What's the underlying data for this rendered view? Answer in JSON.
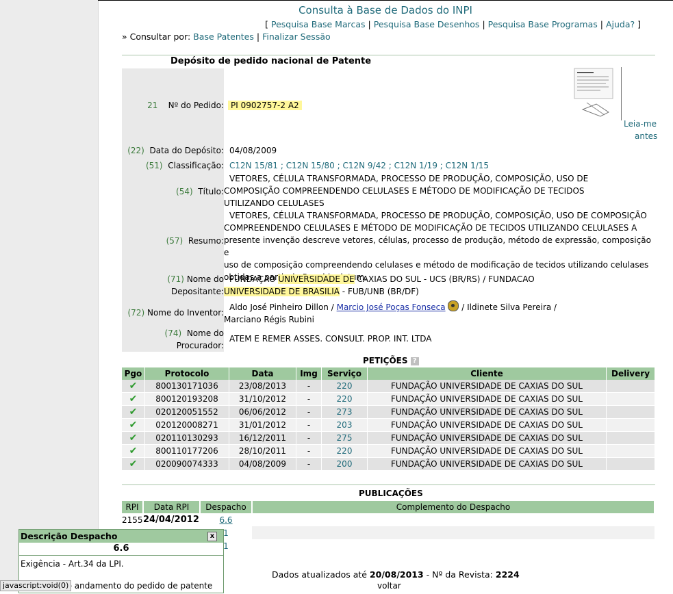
{
  "header": {
    "title": "Consulta à Base de Dados do INPI",
    "links_open": "[",
    "links": [
      "Pesquisa Base Marcas",
      "Pesquisa Base Desenhos",
      "Pesquisa Base Programas",
      "Ajuda?"
    ],
    "links_close": "]",
    "sep": "|",
    "consult_label": "» Consultar por:",
    "consult_links": [
      "Base Patentes",
      "Finalizar Sessão"
    ]
  },
  "patent": {
    "section_title": "Depósito de pedido nacional de Patente",
    "pedido_code": "21",
    "pedido_label": "Nº do Pedido:",
    "pedido_value": "PI 0902757-2 A2",
    "leia_me": "Leia-me",
    "antes": "antes",
    "deposito_code": "(22)",
    "deposito_label": "Data do Depósito:",
    "deposito_value": "04/08/2009",
    "classif_code": "(51)",
    "classif_label": "Classificação:",
    "classif_values": [
      "C12N 15/81",
      "C12N 15/80",
      "C12N 9/42",
      "C12N 1/19",
      "C12N 1/15"
    ],
    "classif_sep": ";",
    "titulo_code": "(54)",
    "titulo_label": "Título:",
    "titulo_lines": [
      "VETORES, CÉLULA TRANSFORMADA, PROCESSO DE PRODUÇÃO, COMPOSIÇÃO, USO DE",
      "COMPOSIÇÃO COMPREENDENDO CELULASES E MÉTODO DE MODIFICAÇÃO DE TECIDOS",
      "UTILIZANDO CELULASES"
    ],
    "resumo_code": "(57)",
    "resumo_label": "Resumo:",
    "resumo_lines": [
      "VETORES, CÉLULA TRANSFORMADA, PROCESSO DE PRODUÇÃO, COMPOSIÇÃO, USO DE COMPOSIÇÃO",
      "COMPREENDENDO CELULASES E MÉTODO DE MODIFICAÇÃO DE TECIDOS UTILIZANDO CELULASES A",
      "presente invenção descreve vetores, células, processo de produção, método de expressão, composição e",
      "uso de composição compreendendo celulases e método de modificação de tecidos utilizando celulases",
      "obtidas a partir de R. echinulatum."
    ],
    "depositante_code": "(71)",
    "depositante_label1": "Nome do",
    "depositante_label2": "Depositante:",
    "depositante_l1_a": "FUNDAÇAO ",
    "depositante_l1_hl": "UNIVERSIDADE DE",
    "depositante_l1_b": " CAXIAS DO SUL - UCS (BR/RS) / FUNDACAO",
    "depositante_l2_hl": "UNIVERSIDADE DE BRASILIA",
    "depositante_l2_b": " - FUB/UNB (BR/DF)",
    "inventor_code": "(72)",
    "inventor_label": "Nome do Inventor:",
    "inventor_a": "Aldo José Pinheiro Dillon /",
    "inventor_link": "Marcio José Poças Fonseca",
    "inventor_b": "/ Ildinete Silva Pereira /",
    "inventor_l2": "Marciano Régis Rubini",
    "procurador_code": "(74)",
    "procurador_label1": "Nome do",
    "procurador_label2": "Procurador:",
    "procurador_value": "ATEM E REMER ASSES. CONSULT. PROP. INT. LTDA"
  },
  "peticoes": {
    "title": "PETIÇÕES",
    "help": "?",
    "headers": [
      "Pgo",
      "Protocolo",
      "Data",
      "Img",
      "Serviço",
      "Cliente",
      "Delivery"
    ],
    "rows": [
      {
        "pgo": "✔",
        "protocolo": "800130171036",
        "data": "23/08/2013",
        "img": "-",
        "servico": "220",
        "cliente": "FUNDAÇÃO UNIVERSIDADE DE CAXIAS DO SUL",
        "delivery": ""
      },
      {
        "pgo": "✔",
        "protocolo": "800120193208",
        "data": "31/10/2012",
        "img": "-",
        "servico": "220",
        "cliente": "FUNDAÇÃO UNIVERSIDADE DE CAXIAS DO SUL",
        "delivery": ""
      },
      {
        "pgo": "✔",
        "protocolo": "020120051552",
        "data": "06/06/2012",
        "img": "-",
        "servico": "273",
        "cliente": "FUNDAÇÃO UNIVERSIDADE DE CAXIAS DO SUL",
        "delivery": ""
      },
      {
        "pgo": "✔",
        "protocolo": "020120008271",
        "data": "31/01/2012",
        "img": "-",
        "servico": "203",
        "cliente": "FUNDAÇÃO UNIVERSIDADE DE CAXIAS DO SUL",
        "delivery": ""
      },
      {
        "pgo": "✔",
        "protocolo": "020110130293",
        "data": "16/12/2011",
        "img": "-",
        "servico": "275",
        "cliente": "FUNDAÇÃO UNIVERSIDADE DE CAXIAS DO SUL",
        "delivery": ""
      },
      {
        "pgo": "✔",
        "protocolo": "800110177206",
        "data": "28/10/2011",
        "img": "-",
        "servico": "220",
        "cliente": "FUNDAÇÃO UNIVERSIDADE DE CAXIAS DO SUL",
        "delivery": ""
      },
      {
        "pgo": "✔",
        "protocolo": "020090074333",
        "data": "04/08/2009",
        "img": "-",
        "servico": "200",
        "cliente": "FUNDAÇÃO UNIVERSIDADE DE CAXIAS DO SUL",
        "delivery": ""
      }
    ]
  },
  "publicacoes": {
    "title": "PUBLICAÇÕES",
    "headers": [
      "RPI",
      "Data RPI",
      "Despacho",
      "Complemento do Despacho"
    ],
    "rows": [
      {
        "rpi": "2155",
        "data": "24/04/2012",
        "despacho": "6.6",
        "complemento": ""
      },
      {
        "rpi": "",
        "data": "",
        "despacho": "1",
        "complemento": ""
      },
      {
        "rpi": "",
        "data": "",
        "despacho": "1",
        "complemento": ""
      }
    ]
  },
  "footer": {
    "updated_prefix": "Dados atualizados até ",
    "updated_date": "20/08/2013",
    "revista_prefix": " - Nº da Revista: ",
    "revista_num": "2224",
    "voltar": "voltar"
  },
  "popup": {
    "title": "Descrição Despacho",
    "close": "x",
    "code": "6.6",
    "line1": "Exigência - Art.34 da LPI.",
    "line2": "do andamento do pedido de patente"
  },
  "statusbar": {
    "text": "javascript:void(0)"
  },
  "colors": {
    "accent": "#1f6a7a",
    "table_header": "#9fc99f",
    "highlight": "#fff79a"
  }
}
